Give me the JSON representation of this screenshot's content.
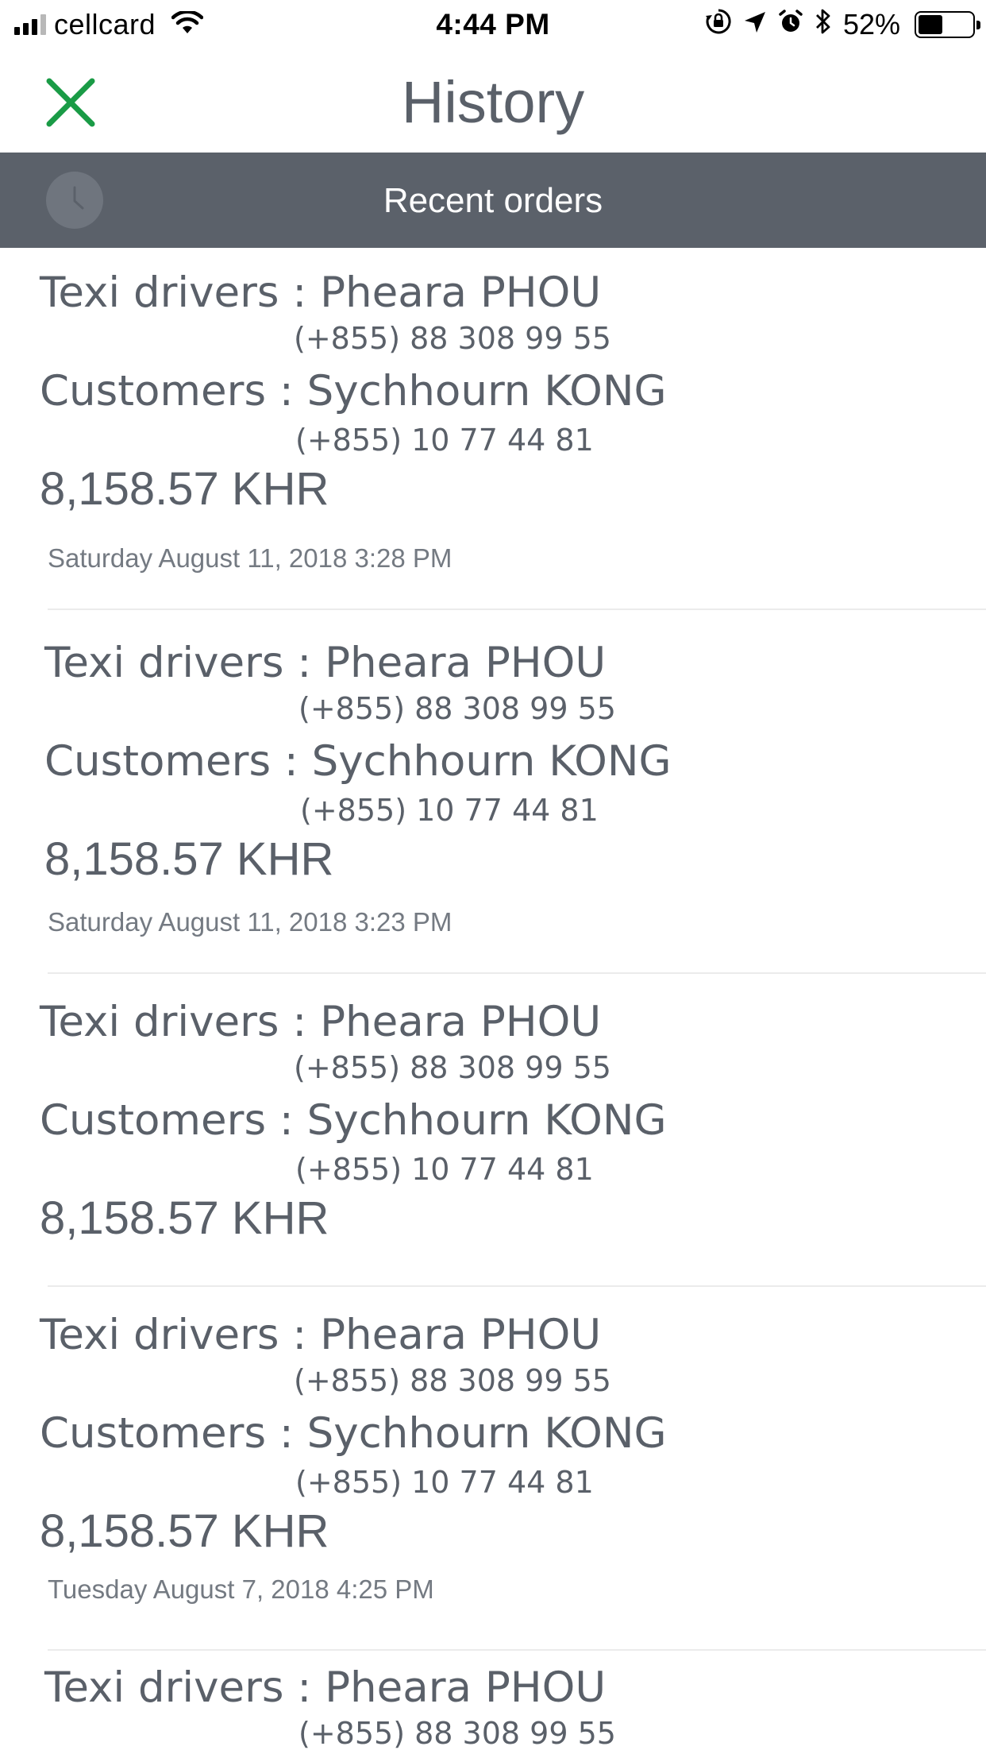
{
  "status_bar": {
    "carrier": "cellcard",
    "time": "4:44 PM",
    "battery": "52%",
    "icons": [
      "signal-icon",
      "wifi-icon",
      "orientation-lock-icon",
      "location-icon",
      "alarm-icon",
      "bluetooth-icon",
      "battery-icon"
    ]
  },
  "header": {
    "title": "History",
    "close_icon": "close-icon",
    "accent_color": "#1a9b46"
  },
  "section": {
    "title": "Recent orders",
    "icon": "clock-icon",
    "background_color": "#5b616a"
  },
  "orders": [
    {
      "driver_label": "Texi drivers : Pheara PHOU",
      "driver_phone": "(+855) 88 308 99 55",
      "customer_label": "Customers  : Sychhourn KONG",
      "customer_phone": "(+855) 10 77 44 81",
      "amount": "8,158.57 KHR",
      "date": "Saturday August 11, 2018 3:28 PM"
    },
    {
      "driver_label": "Texi drivers : Pheara PHOU",
      "driver_phone": "(+855) 88 308 99 55",
      "customer_label": "Customers  : Sychhourn KONG",
      "customer_phone": "(+855) 10 77 44 81",
      "amount": "8,158.57 KHR",
      "date": "Saturday August 11, 2018 3:23 PM"
    },
    {
      "driver_label": "Texi drivers : Pheara PHOU",
      "driver_phone": "(+855) 88 308 99 55",
      "customer_label": "Customers  : Sychhourn KONG",
      "customer_phone": "(+855) 10 77 44 81",
      "amount": "8,158.57 KHR",
      "date": ""
    },
    {
      "driver_label": "Texi drivers : Pheara PHOU",
      "driver_phone": "(+855) 88 308 99 55",
      "customer_label": "Customers  : Sychhourn KONG",
      "customer_phone": "(+855) 10 77 44 81",
      "amount": "8,158.57 KHR",
      "date": "Tuesday August 7, 2018 4:25 PM"
    },
    {
      "driver_label": "Texi drivers : Pheara PHOU",
      "driver_phone": "(+855) 88 308 99 55"
    }
  ]
}
